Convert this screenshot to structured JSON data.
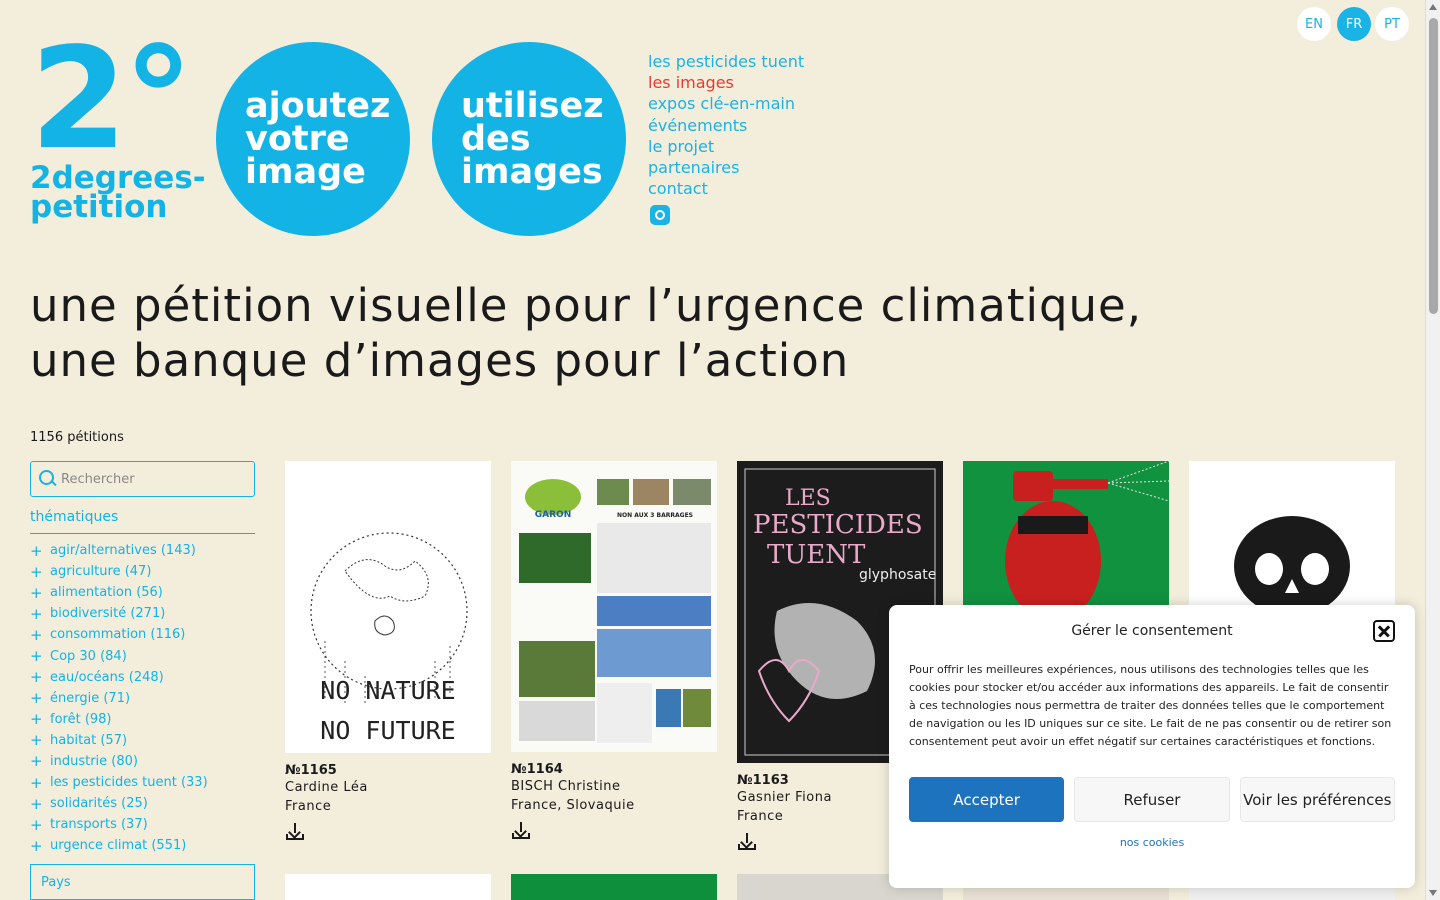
{
  "languages": [
    {
      "code": "EN",
      "active": false
    },
    {
      "code": "FR",
      "active": true
    },
    {
      "code": "PT",
      "active": false
    }
  ],
  "logo": {
    "big": "2°",
    "line1": "2degrees-",
    "line2": "petition"
  },
  "circles": [
    {
      "lines": [
        "ajoutez",
        "votre",
        "image"
      ]
    },
    {
      "lines": [
        "utilisez",
        "des",
        "images"
      ]
    }
  ],
  "nav": [
    {
      "label": "les pesticides tuent",
      "current": false
    },
    {
      "label": "les images",
      "current": true
    },
    {
      "label": "expos clé-en-main",
      "current": false
    },
    {
      "label": "événements",
      "current": false
    },
    {
      "label": "le projet",
      "current": false
    },
    {
      "label": "partenaires",
      "current": false
    },
    {
      "label": "contact",
      "current": false
    }
  ],
  "hero": {
    "line1": "une pétition visuelle pour l’urgence climatique,",
    "line2": "une banque d’images pour l’action"
  },
  "count": "1156 pétitions",
  "search": {
    "placeholder": "Rechercher"
  },
  "themes_title": "thématiques",
  "themes": [
    "agir/alternatives (143)",
    "agriculture (47)",
    "alimentation (56)",
    "biodiversité (271)",
    "consommation (116)",
    "Cop 30 (84)",
    "eau/océans (248)",
    "énergie (71)",
    "forêt (98)",
    "habitat (57)",
    "industrie (80)",
    "les pesticides tuent (33)",
    "solidarités (25)",
    "transports (37)",
    "urgence climat (551)"
  ],
  "pays_label": "Pays",
  "cards": [
    {
      "num": "№1165",
      "name": "Cardine Léa",
      "country": "France",
      "poster_text": [
        "NO NATURE",
        "NO FUTURE"
      ]
    },
    {
      "num": "№1164",
      "name": "BISCH Christine",
      "country": "France, Slovaquie",
      "poster_text": [
        "GARON",
        "NON AUX 3 BARRAGES"
      ]
    },
    {
      "num": "№1163",
      "name": "Gasnier Fiona",
      "country": "France",
      "poster_text": [
        "LES",
        "PESTICIDES",
        "TUENT",
        "glyphosate"
      ]
    },
    {
      "num": "",
      "name": "",
      "country": "",
      "poster_text": []
    },
    {
      "num": "",
      "name": "",
      "country": "",
      "poster_text": []
    }
  ],
  "consent": {
    "title": "Gérer le consentement",
    "text": "Pour offrir les meilleures expériences, nous utilisons des technologies telles que les cookies pour stocker et/ou accéder aux informations des appareils. Le fait de consentir à ces technologies nous permettra de traiter des données telles que le comportement de navigation ou les ID uniques sur ce site. Le fait de ne pas consentir ou de retirer son consentement peut avoir un effet négatif sur certaines caractéristiques et fonctions.",
    "accept": "Accepter",
    "refuse": "Refuser",
    "prefs": "Voir les préférences",
    "link": "nos cookies"
  },
  "colors": {
    "accent": "#13b3e6",
    "current_nav": "#e53c2e",
    "background": "#f3eddc",
    "consent_primary": "#1e73be"
  }
}
